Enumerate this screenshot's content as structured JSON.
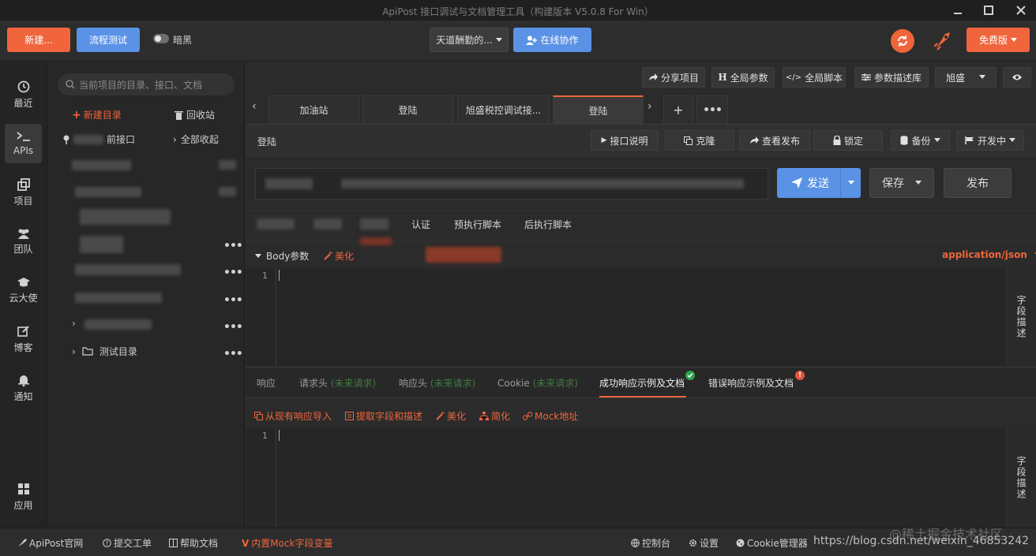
{
  "window": {
    "title": "ApiPost 接口调试与文档管理工具（构建版本 V5.0.8 For Win）"
  },
  "toolbar": {
    "new_label": "新建...",
    "flow_test_label": "流程测试",
    "dark_label": "暗黑",
    "team_select": "天道酬勤的...",
    "collab_label": "在线协作",
    "free_label": "免费版"
  },
  "leftnav": [
    {
      "label": "最近"
    },
    {
      "label": "APIs"
    },
    {
      "label": "项目"
    },
    {
      "label": "团队"
    },
    {
      "label": "云大使"
    },
    {
      "label": "博客"
    },
    {
      "label": "通知"
    },
    {
      "label": "应用"
    }
  ],
  "tree": {
    "search_placeholder": "当前项目的目录、接口、文档",
    "new_dir": "新建目录",
    "recycle": "回收站",
    "shared_label": "前接口",
    "collapse_all": "全部收起",
    "test_dir": "测试目录"
  },
  "project_bar": {
    "share": "分享项目",
    "global_params": "全局参数",
    "global_script": "全局脚本",
    "param_lib": "参数描述库",
    "env": "旭盛"
  },
  "tabs": [
    "加油站",
    "登陆",
    "旭盛税控调试接...",
    "登陆"
  ],
  "request": {
    "name": "登陆",
    "doc_btn": "接口说明",
    "clone_btn": "克隆",
    "view_publish_btn": "查看发布",
    "lock_btn": "锁定",
    "backup_btn": "备份",
    "status_btn": "开发中",
    "send_label": "发送",
    "save_label": "保存",
    "publish_label": "发布"
  },
  "subtabs": {
    "auth": "认证",
    "pre_script": "预执行脚本",
    "post_script": "后执行脚本"
  },
  "body": {
    "label": "Body参数",
    "beautify": "美化",
    "content_type": "application/json",
    "line": "1",
    "field_desc": "字段描述"
  },
  "response": {
    "tabs": [
      {
        "label": "响应",
        "sub": ""
      },
      {
        "label": "请求头",
        "sub": "(未来请求)"
      },
      {
        "label": "响应头",
        "sub": "(未来请求)"
      },
      {
        "label": "Cookie",
        "sub": "(未来请求)"
      }
    ],
    "success_tab": "成功响应示例及文档",
    "error_tab": "错误响应示例及文档",
    "import": "从现有响应导入",
    "extract": "提取字段和描述",
    "beautify": "美化",
    "simplify": "简化",
    "mock": "Mock地址",
    "line": "1",
    "field_desc": "字段描述"
  },
  "status": {
    "site": "ApiPost官网",
    "ticket": "提交工单",
    "help": "帮助文档",
    "mock_vars": "内置Mock字段变量",
    "console": "控制台",
    "settings": "设置",
    "cookie": "Cookie管理器",
    "watermark": "https://blog.csdn.net/weixin_46853242",
    "watermark2": "@稀土掘金技术社区"
  },
  "colors": {
    "accent": "#f0653c",
    "primary": "#5a92e6",
    "success": "#2ea44f",
    "error": "#e5533d"
  }
}
